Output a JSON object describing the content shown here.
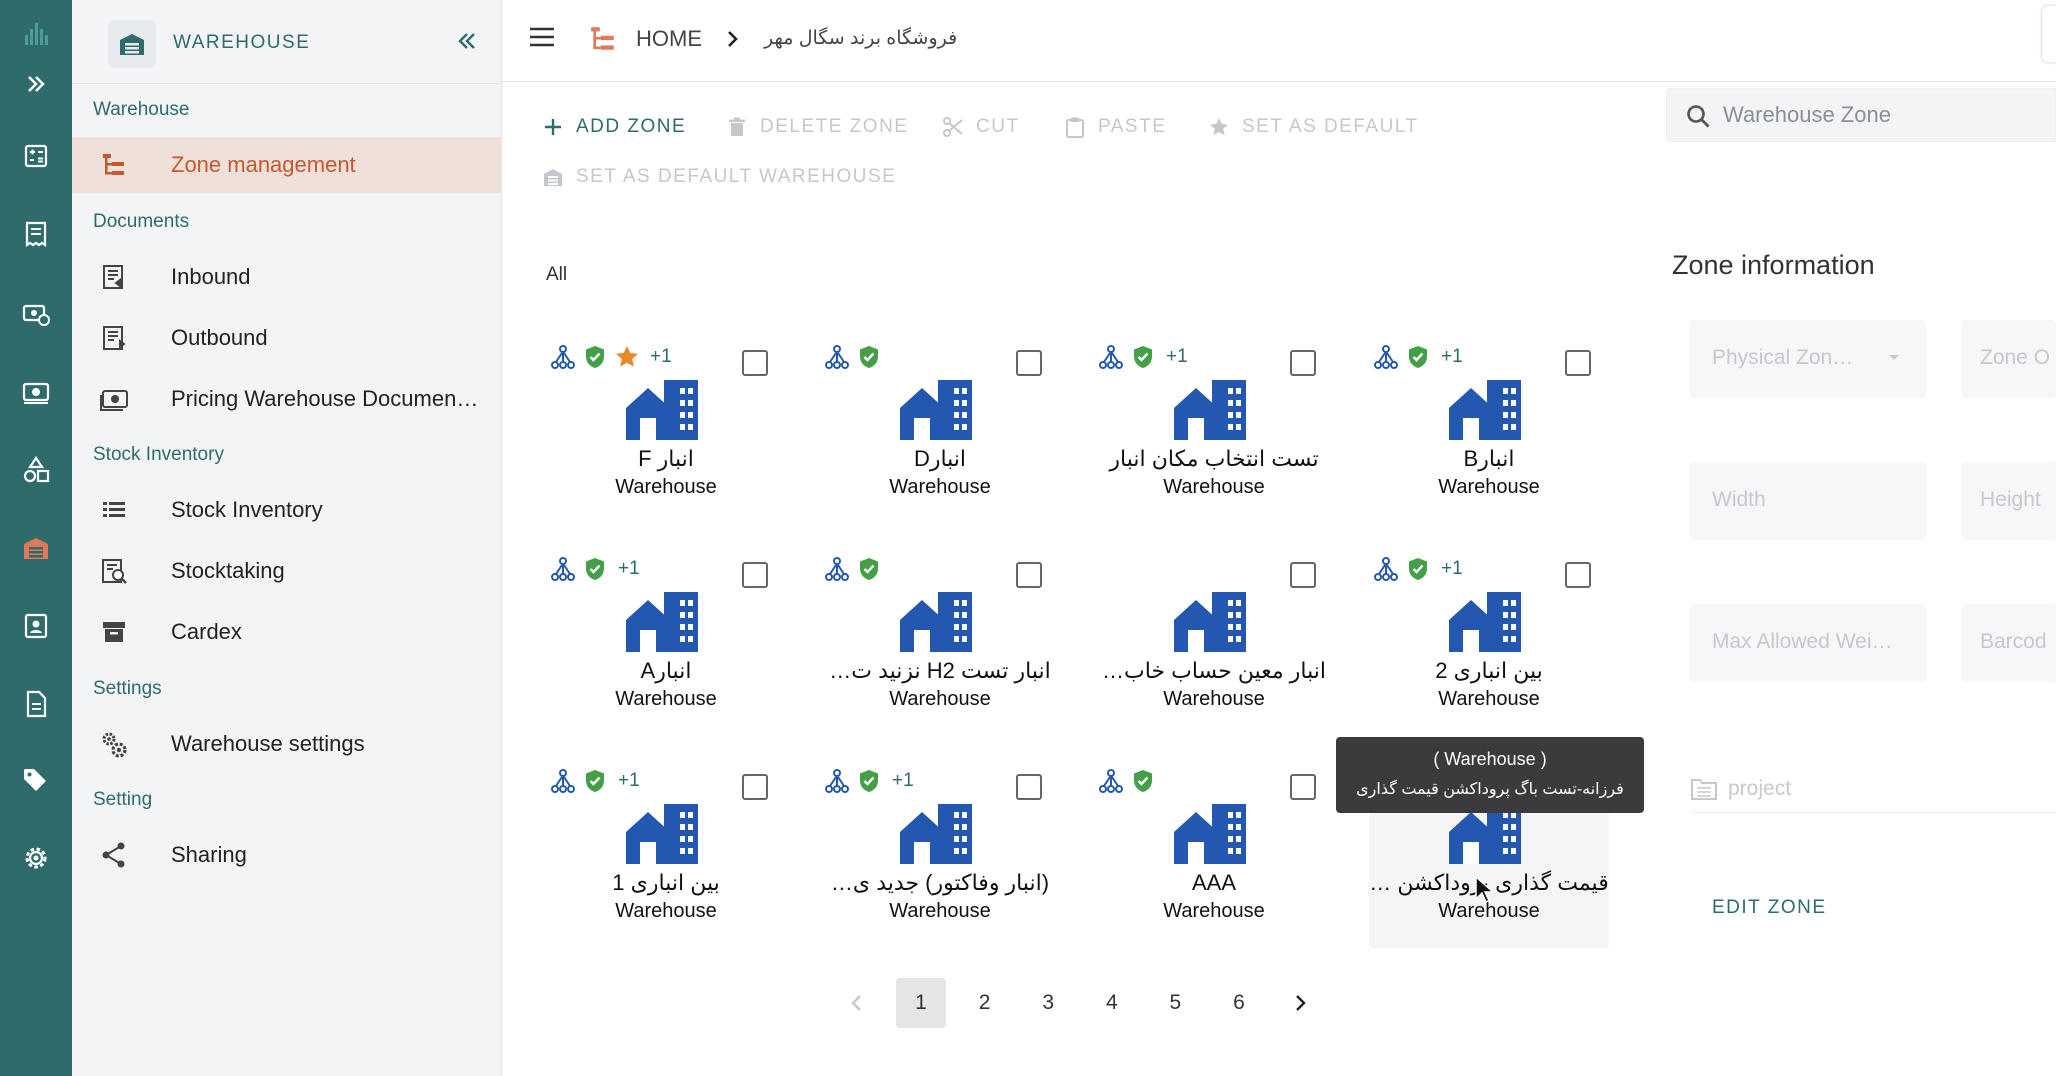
{
  "rail": {
    "items": [
      "app-logo-icon",
      "expand-icon",
      "calculator-icon",
      "receipt-icon",
      "money-sync-icon",
      "banknote-icon",
      "shapes-icon",
      "warehouse-icon",
      "contact-card-icon",
      "document-icon",
      "tags-icon",
      "gear-icon"
    ],
    "active": "warehouse-icon"
  },
  "sidebar": {
    "title": "WAREHOUSE",
    "sections": [
      {
        "label": "Warehouse",
        "items": [
          {
            "label": "Zone management",
            "icon": "tree-icon",
            "active": true
          }
        ]
      },
      {
        "label": "Documents",
        "items": [
          {
            "label": "Inbound",
            "icon": "inbound-doc-icon"
          },
          {
            "label": "Outbound",
            "icon": "outbound-doc-icon"
          },
          {
            "label": "Pricing Warehouse Documen…",
            "icon": "pricing-doc-icon"
          }
        ]
      },
      {
        "label": "Stock Inventory",
        "items": [
          {
            "label": "Stock Inventory",
            "icon": "list-icon"
          },
          {
            "label": "Stocktaking",
            "icon": "stocktaking-icon"
          },
          {
            "label": "Cardex",
            "icon": "archive-icon"
          }
        ]
      },
      {
        "label": "Settings",
        "items": [
          {
            "label": "Warehouse settings",
            "icon": "gears-icon"
          }
        ]
      },
      {
        "label": "Setting",
        "items": [
          {
            "label": "Sharing",
            "icon": "share-icon"
          }
        ]
      }
    ]
  },
  "breadcrumb": {
    "home": "HOME",
    "current": "فروشگاه برند سگال مهر"
  },
  "toolbar": {
    "add_zone": "ADD ZONE",
    "delete_zone": "DELETE ZONE",
    "cut": "CUT",
    "paste": "PASTE",
    "set_default": "SET AS DEFAULT",
    "set_default_warehouse": "SET AS DEFAULT WAREHOUSE"
  },
  "search": {
    "placeholder": "Warehouse Zone"
  },
  "filter": {
    "label": "All"
  },
  "cards": [
    {
      "name": "انبار F",
      "type": "Warehouse",
      "tree": true,
      "shield": true,
      "star": true,
      "plus": "+1"
    },
    {
      "name": "انبارD",
      "type": "Warehouse",
      "tree": true,
      "shield": true,
      "star": false,
      "plus": ""
    },
    {
      "name": "تست انتخاب مکان انبار",
      "type": "Warehouse",
      "tree": true,
      "shield": true,
      "star": false,
      "plus": "+1"
    },
    {
      "name": "انبارB",
      "type": "Warehouse",
      "tree": true,
      "shield": true,
      "star": false,
      "plus": "+1"
    },
    {
      "name": "انبارA",
      "type": "Warehouse",
      "tree": true,
      "shield": true,
      "star": false,
      "plus": "+1"
    },
    {
      "name": "انبار تست H2 نزنید ت…",
      "type": "Warehouse",
      "tree": true,
      "shield": true,
      "star": false,
      "plus": ""
    },
    {
      "name": "انبار معین حساب خاب…",
      "type": "Warehouse",
      "tree": false,
      "shield": false,
      "star": false,
      "plus": ""
    },
    {
      "name": "بین انباری 2",
      "type": "Warehouse",
      "tree": true,
      "shield": true,
      "star": false,
      "plus": "+1"
    },
    {
      "name": "بین انباری 1",
      "type": "Warehouse",
      "tree": true,
      "shield": true,
      "star": false,
      "plus": "+1"
    },
    {
      "name": "(انبار وفاکتور) جدید ی…",
      "type": "Warehouse",
      "tree": true,
      "shield": true,
      "star": false,
      "plus": "+1"
    },
    {
      "name": "AAA",
      "type": "Warehouse",
      "tree": true,
      "shield": true,
      "star": false,
      "plus": ""
    },
    {
      "name": "قیمت گذاری پروداکشن …",
      "type": "Warehouse",
      "tree": false,
      "shield": false,
      "star": false,
      "plus": ""
    }
  ],
  "tooltip": {
    "line1": "( Warehouse )",
    "line2": "فرزانه-تست باگ پروداکشن قیمت گذاری"
  },
  "zone_info": {
    "title": "Zone information",
    "physical_zone": "Physical Zon…",
    "zone_other": "Zone O",
    "width": "Width",
    "height": "Height",
    "max_weight": "Max Allowed Wei…",
    "barcode": "Barcod",
    "project": "project",
    "edit_zone": "EDIT ZONE"
  },
  "pagination": {
    "pages": [
      "1",
      "2",
      "3",
      "4",
      "5",
      "6"
    ],
    "current": "1"
  },
  "colors": {
    "teal": "#2f6b6b",
    "accent_orange": "#c8582f",
    "building_blue": "#2458b0",
    "shield_green": "#43a047",
    "star_orange": "#e8892a"
  }
}
